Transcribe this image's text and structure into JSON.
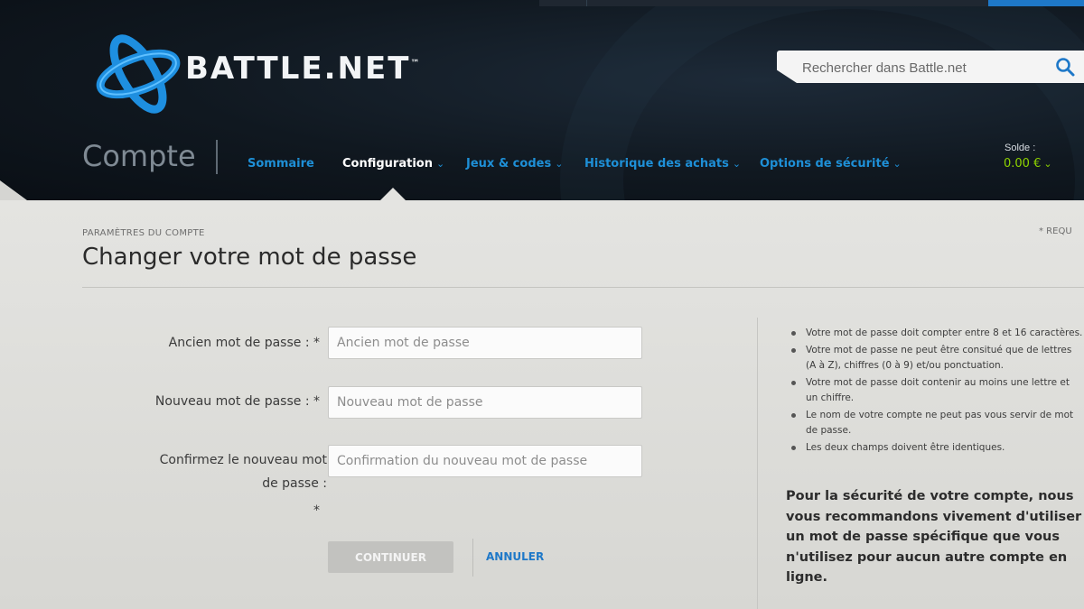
{
  "brand": {
    "name": "BATTLE.NET",
    "trademark": "™"
  },
  "search": {
    "placeholder": "Rechercher dans Battle.net"
  },
  "section": {
    "title": "Compte"
  },
  "nav": {
    "items": [
      {
        "label": "Sommaire",
        "dropdown": false,
        "active": false
      },
      {
        "label": "Configuration",
        "dropdown": true,
        "active": true
      },
      {
        "label": "Jeux & codes",
        "dropdown": true,
        "active": false
      },
      {
        "label": "Historique des achats",
        "dropdown": true,
        "active": false
      },
      {
        "label": "Options de sécurité",
        "dropdown": true,
        "active": false
      }
    ]
  },
  "balance": {
    "label": "Solde :",
    "value": "0.00 €"
  },
  "page": {
    "breadcrumb": "PARAMÈTRES DU COMPTE",
    "required_note": "* REQU",
    "title": "Changer votre mot de passe"
  },
  "form": {
    "old_label": "Ancien mot de passe : *",
    "old_placeholder": "Ancien mot de passe",
    "new_label": "Nouveau mot de passe : *",
    "new_placeholder": "Nouveau mot de passe",
    "confirm_label_line1": "Confirmez le nouveau mot",
    "confirm_label_line2": "de passe :",
    "confirm_label_line3": "*",
    "confirm_placeholder": "Confirmation du nouveau mot de passe",
    "continue_label": "CONTINUER",
    "cancel_label": "ANNULER"
  },
  "rules": [
    "Votre mot de passe doit compter entre 8 et 16 caractères.",
    "Votre mot de passe ne peut être consitué que de lettres (A à Z), chiffres (0 à 9) et/ou ponctuation.",
    "Votre mot de passe doit contenir au moins une lettre et un chiffre.",
    "Le nom de votre compte ne peut pas vous servir de mot de passe.",
    "Les deux champs doivent être identiques."
  ],
  "advice": "Pour la sécurité de votre compte, nous vous recommandons vivement d'utiliser un mot de passe spécifique que vous n'utilisez pour aucun autre compte en ligne.",
  "colors": {
    "accent": "#1e8fd6",
    "balance": "#8fd400",
    "header_bg": "#101820"
  },
  "icons": {
    "logo": "battlenet-logo-icon",
    "search": "search-icon",
    "chevron": "chevron-down-icon"
  }
}
